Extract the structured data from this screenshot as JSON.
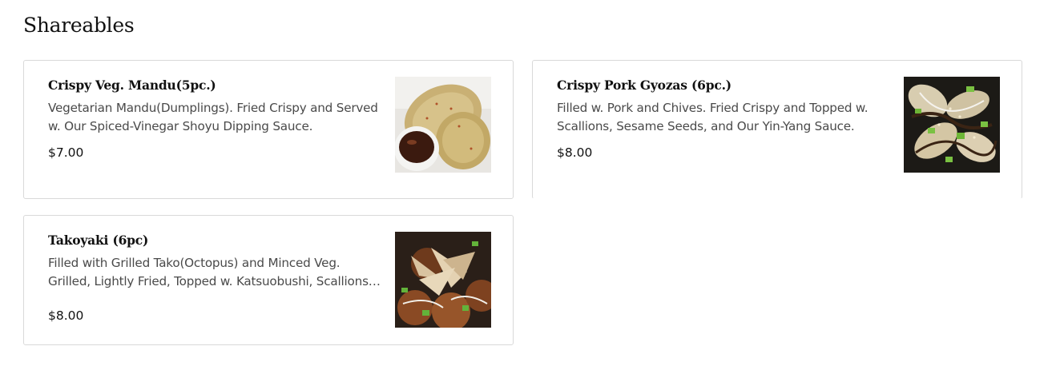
{
  "section": {
    "title": "Shareables"
  },
  "items": [
    {
      "name": "Crispy Veg. Mandu(5pc.)",
      "description": "Vegetarian Mandu(Dumplings). Fried Crispy and Served w. Our Spiced-Vinegar Shoyu Dipping Sauce.",
      "price": "$7.00",
      "image_alt": "fried dumplings with dipping sauce"
    },
    {
      "name": "Crispy Pork Gyozas (6pc.)",
      "description": "Filled w. Pork and Chives. Fried Crispy and Topped w. Scallions, Sesame Seeds, and Our Yin-Yang Sauce.",
      "price": "$8.00",
      "image_alt": "gyozas topped with scallions and sesame seeds"
    },
    {
      "name": "Takoyaki (6pc)",
      "description": "Filled with Grilled Tako(Octopus) and Minced Veg. Grilled, Lightly Fried, Topped w. Katsuobushi, Scallions and Sauce.",
      "price": "$8.00",
      "image_alt": "takoyaki topped with katsuobushi"
    }
  ]
}
